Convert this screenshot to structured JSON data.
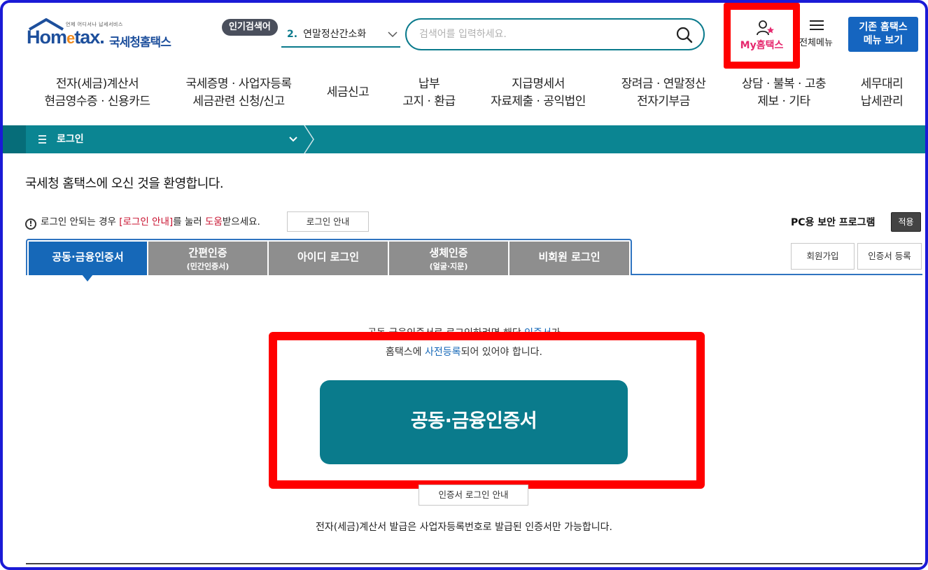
{
  "header": {
    "logo_tagline": "언제 어디서나 납세서비스",
    "logo_text_home": "Hom",
    "logo_text_e": "e",
    "logo_text_tax": "tax.",
    "logo_korean": "국세청홈택스",
    "popular_badge": "인기검색어",
    "popular_rank": "2.",
    "popular_term": "연말정산간소화",
    "search_placeholder": "검색어를 입력하세요.",
    "my_hometax": "My홈택스",
    "all_menu": "전체메뉴",
    "old_menu_line1": "기존 홈택스",
    "old_menu_line2": "메뉴 보기"
  },
  "nav": [
    {
      "line1": "전자(세금)계산서",
      "line2": "현금영수증 · 신용카드"
    },
    {
      "line1": "국세증명 · 사업자등록",
      "line2": "세금관련 신청/신고"
    },
    {
      "line1": "세금신고",
      "line2": ""
    },
    {
      "line1": "납부",
      "line2": "고지 · 환급"
    },
    {
      "line1": "지급명세서",
      "line2": "자료제출 · 공익법인"
    },
    {
      "line1": "장려금 · 연말정산",
      "line2": "전자기부금"
    },
    {
      "line1": "상담 · 불복 · 고충",
      "line2": "제보 · 기타"
    },
    {
      "line1": "세무대리",
      "line2": "납세관리"
    }
  ],
  "breadcrumb": {
    "label": "로그인"
  },
  "content": {
    "welcome": "국세청 홈택스에 오신 것을 환영합니다.",
    "notice_pre": "로그인 안되는 경우 ",
    "notice_link": "[로그인 안내]",
    "notice_mid": "를 눌러 ",
    "notice_help": "도움",
    "notice_post": "받으세요.",
    "login_guide_button": "로그인 안내",
    "pc_security": "PC용 보안 프로그램",
    "apply_button": "적용",
    "join_button": "회원가입",
    "cert_register_button": "인증서 등록",
    "tabs": [
      {
        "label": "공동·금융인증서",
        "sub": ""
      },
      {
        "label": "간편인증",
        "sub": "(민간인증서)"
      },
      {
        "label": "아이디 로그인",
        "sub": ""
      },
      {
        "label": "생체인증",
        "sub": "(얼굴·지문)"
      },
      {
        "label": "비회원 로그인",
        "sub": ""
      }
    ],
    "desc1_pre": "공동·금융인증서로 로그인하려면 해당 ",
    "desc1_link": "인증서",
    "desc1_post": "가",
    "desc2_pre": "홈택스에 ",
    "desc2_link": "사전등록",
    "desc2_post": "되어 있어야 합니다.",
    "main_button": "공동·금융인증서",
    "cert_login_guide": "인증서 로그인 안내",
    "footnote": "전자(세금)계산서 발급은 사업자등록번호로 발급된 인증서만 가능합니다."
  },
  "colors": {
    "teal": "#0b8592",
    "blue_tab": "#1668b8",
    "highlight_red": "#ff0000",
    "my_hometax_pink": "#e6286e",
    "old_menu_blue": "#1565c0"
  }
}
